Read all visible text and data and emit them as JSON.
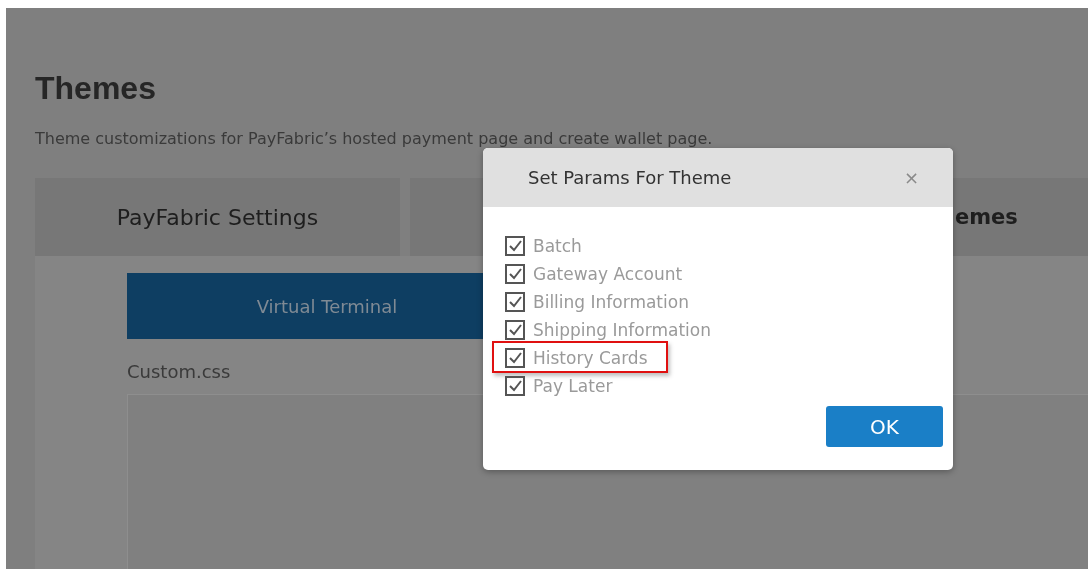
{
  "page": {
    "title": "Themes",
    "subtitle": "Theme customizations for PayFabric’s hosted payment page and create wallet page."
  },
  "tabs": [
    {
      "label": "PayFabric Settings"
    },
    {
      "label": "emes"
    }
  ],
  "subtab": {
    "label": "Virtual Terminal"
  },
  "editor": {
    "label": "Custom.css"
  },
  "dialog": {
    "title": "Set Params For Theme",
    "close": "×",
    "options": [
      {
        "label": "Batch",
        "checked": true,
        "highlighted": false
      },
      {
        "label": "Gateway Account",
        "checked": true,
        "highlighted": false
      },
      {
        "label": "Billing Information",
        "checked": true,
        "highlighted": false
      },
      {
        "label": "Shipping Information",
        "checked": true,
        "highlighted": false
      },
      {
        "label": "History Cards",
        "checked": true,
        "highlighted": true
      },
      {
        "label": "Pay Later",
        "checked": true,
        "highlighted": false
      }
    ],
    "ok": "OK"
  }
}
